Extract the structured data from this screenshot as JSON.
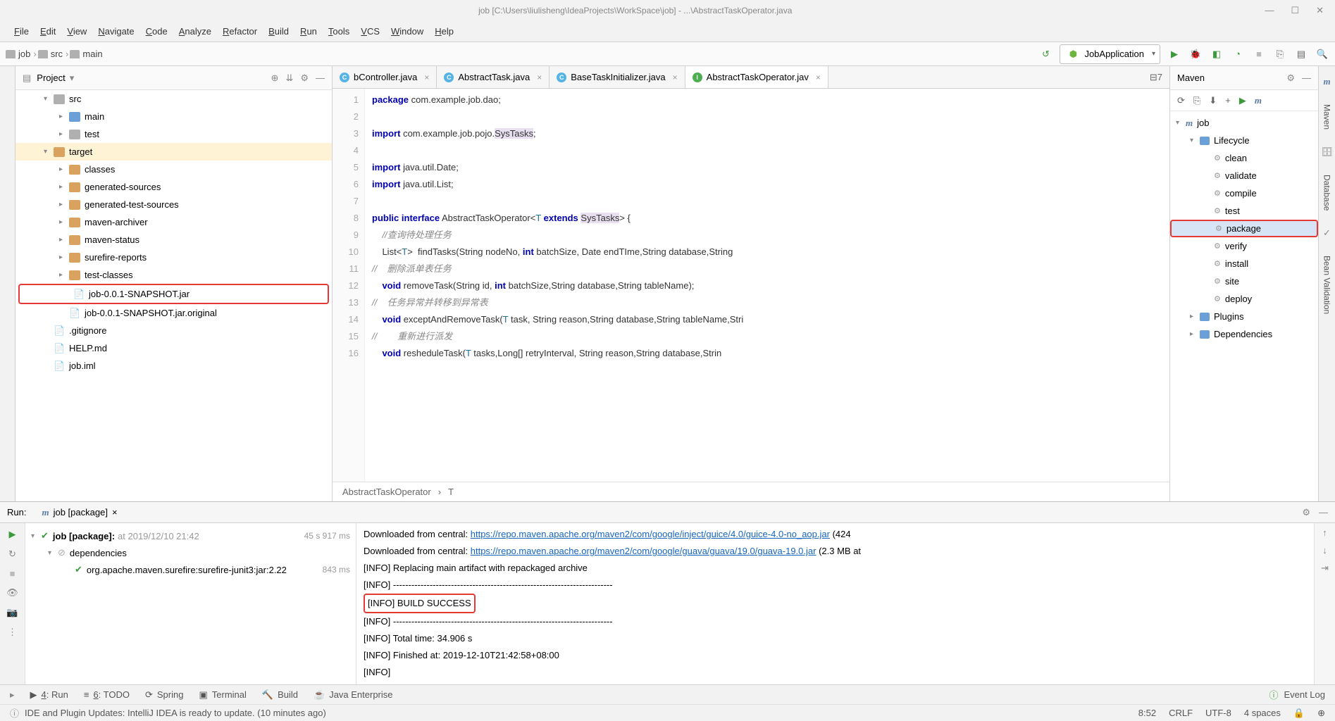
{
  "window": {
    "path": "job [C:\\Users\\liulisheng\\IdeaProjects\\WorkSpace\\job] - ...\\AbstractTaskOperator.java"
  },
  "menu": [
    "File",
    "Edit",
    "View",
    "Navigate",
    "Code",
    "Analyze",
    "Refactor",
    "Build",
    "Run",
    "Tools",
    "VCS",
    "Window",
    "Help"
  ],
  "breadcrumbs": [
    "job",
    "src",
    "main"
  ],
  "run_config": "JobApplication",
  "project": {
    "title": "Project",
    "tree": [
      {
        "d": 1,
        "arrow": "▾",
        "icon": "fgray",
        "label": "src"
      },
      {
        "d": 2,
        "arrow": "▸",
        "icon": "fblue",
        "label": "main"
      },
      {
        "d": 2,
        "arrow": "▸",
        "icon": "fgray",
        "label": "test"
      },
      {
        "d": 1,
        "arrow": "▾",
        "icon": "forange",
        "label": "target",
        "sel": true
      },
      {
        "d": 2,
        "arrow": "▸",
        "icon": "forange",
        "label": "classes"
      },
      {
        "d": 2,
        "arrow": "▸",
        "icon": "forange",
        "label": "generated-sources"
      },
      {
        "d": 2,
        "arrow": "▸",
        "icon": "forange",
        "label": "generated-test-sources"
      },
      {
        "d": 2,
        "arrow": "▸",
        "icon": "forange",
        "label": "maven-archiver"
      },
      {
        "d": 2,
        "arrow": "▸",
        "icon": "forange",
        "label": "maven-status"
      },
      {
        "d": 2,
        "arrow": "▸",
        "icon": "forange",
        "label": "surefire-reports"
      },
      {
        "d": 2,
        "arrow": "▸",
        "icon": "forange",
        "label": "test-classes"
      },
      {
        "d": 2,
        "arrow": "",
        "icon": "",
        "label": "job-0.0.1-SNAPSHOT.jar",
        "boxed": true
      },
      {
        "d": 2,
        "arrow": "",
        "icon": "",
        "label": "job-0.0.1-SNAPSHOT.jar.original"
      },
      {
        "d": 1,
        "arrow": "",
        "icon": "",
        "label": ".gitignore"
      },
      {
        "d": 1,
        "arrow": "",
        "icon": "",
        "label": "HELP.md"
      },
      {
        "d": 1,
        "arrow": "",
        "icon": "",
        "label": "job.iml"
      }
    ]
  },
  "tabs": [
    {
      "label": "bController.java",
      "icon": "c"
    },
    {
      "label": "AbstractTask.java",
      "icon": "c"
    },
    {
      "label": "BaseTaskInitializer.java",
      "icon": "c"
    },
    {
      "label": "AbstractTaskOperator.jav",
      "icon": "i",
      "active": true
    }
  ],
  "tabs_problems": "⊟7",
  "code_lines": [
    "package com.example.job.dao;",
    "",
    "import com.example.job.pojo.SysTasks;",
    "",
    "import java.util.Date;",
    "import java.util.List;",
    "",
    "public interface AbstractTaskOperator<T extends SysTasks> {",
    "    //查询待处理任务",
    "    List<T>  findTasks(String nodeNo, int batchSize, Date endTIme,String database,String",
    "//    删除派单表任务",
    "    void removeTask(String id, int batchSize,String database,String tableName);",
    "//    任务异常并转移到异常表",
    "    void exceptAndRemoveTask(T task, String reason,String database,String tableName,Stri",
    "//        重新进行派发",
    "    void resheduleTask(T tasks,Long[] retryInterval, String reason,String database,Strin"
  ],
  "line_start": 1,
  "breadcrumb_editor": [
    "AbstractTaskOperator",
    "T"
  ],
  "maven": {
    "title": "Maven",
    "tree": [
      {
        "d": 0,
        "arrow": "▾",
        "label": "job",
        "icon": "m"
      },
      {
        "d": 1,
        "arrow": "▾",
        "label": "Lifecycle",
        "icon": "folder"
      },
      {
        "d": 2,
        "gear": true,
        "label": "clean"
      },
      {
        "d": 2,
        "gear": true,
        "label": "validate"
      },
      {
        "d": 2,
        "gear": true,
        "label": "compile"
      },
      {
        "d": 2,
        "gear": true,
        "label": "test"
      },
      {
        "d": 2,
        "gear": true,
        "label": "package",
        "sel": true,
        "boxed": true
      },
      {
        "d": 2,
        "gear": true,
        "label": "verify"
      },
      {
        "d": 2,
        "gear": true,
        "label": "install"
      },
      {
        "d": 2,
        "gear": true,
        "label": "site"
      },
      {
        "d": 2,
        "gear": true,
        "label": "deploy"
      },
      {
        "d": 1,
        "arrow": "▸",
        "label": "Plugins",
        "icon": "folder"
      },
      {
        "d": 1,
        "arrow": "▸",
        "label": "Dependencies",
        "icon": "folder"
      }
    ]
  },
  "right_tabs": [
    "Maven",
    "Database",
    "Bean Validation"
  ],
  "run": {
    "label": "Run:",
    "tab": "job [package]",
    "tree": [
      {
        "d": 0,
        "arrow": "▾",
        "ok": true,
        "label": "job [package]:",
        "meta": "at 2019/12/10 21:42",
        "time": "45 s 917 ms"
      },
      {
        "d": 1,
        "arrow": "▾",
        "ok": false,
        "circle": true,
        "label": "dependencies",
        "time": ""
      },
      {
        "d": 2,
        "arrow": "",
        "ok": true,
        "label": "org.apache.maven.surefire:surefire-junit3:jar:2.22",
        "time": "843 ms"
      }
    ],
    "console": [
      {
        "pre": "Downloaded from central: ",
        "link": "https://repo.maven.apache.org/maven2/com/google/inject/guice/4.0/guice-4.0-no_aop.jar",
        "post": " (424"
      },
      {
        "pre": "Downloaded from central: ",
        "link": "https://repo.maven.apache.org/maven2/com/google/guava/guava/19.0/guava-19.0.jar",
        "post": " (2.3 MB at"
      },
      {
        "text": "[INFO] Replacing main artifact with repackaged archive"
      },
      {
        "text": "[INFO] ------------------------------------------------------------------------"
      },
      {
        "text": "[INFO] BUILD SUCCESS",
        "boxed": true
      },
      {
        "text": "[INFO] ------------------------------------------------------------------------"
      },
      {
        "text": "[INFO] Total time:  34.906 s"
      },
      {
        "text": "[INFO] Finished at: 2019-12-10T21:42:58+08:00"
      },
      {
        "text": "[INFO]"
      }
    ]
  },
  "status_tools": [
    {
      "icon": "▶",
      "label": "4: Run",
      "u": true
    },
    {
      "icon": "≡",
      "label": "6: TODO",
      "u": true
    },
    {
      "icon": "⟳",
      "label": "Spring"
    },
    {
      "icon": "▣",
      "label": "Terminal"
    },
    {
      "icon": "🔨",
      "label": "Build"
    },
    {
      "icon": "☕",
      "label": "Java Enterprise"
    }
  ],
  "event_log": "Event Log",
  "status_msg": "IDE and Plugin Updates: IntelliJ IDEA is ready to update. (10 minutes ago)",
  "status_right": [
    "8:52",
    "CRLF",
    "UTF-8",
    "4 spaces",
    "🔒",
    "⊕"
  ]
}
